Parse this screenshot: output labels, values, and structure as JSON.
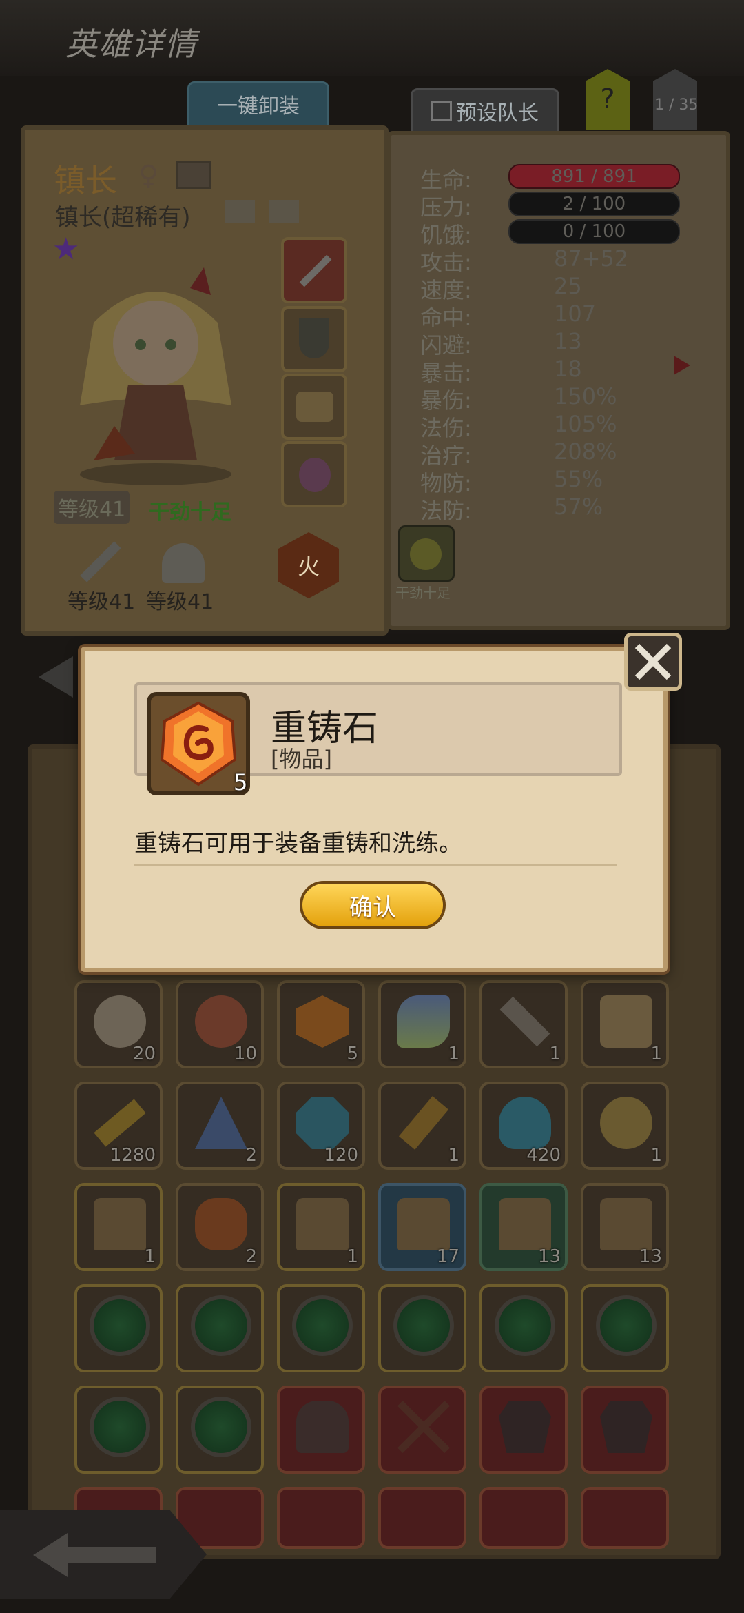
{
  "header": {
    "title": "英雄详情",
    "unequip_all": "一键卸装",
    "preset_leader": "预设队长",
    "help_symbol": "?",
    "page_counter": "1 / 35"
  },
  "hero": {
    "name": "镇长",
    "subtitle": "镇长(超稀有)",
    "level": "等级41",
    "status": "干劲十足",
    "equip_labels": [
      "等级41",
      "等级41"
    ],
    "element": "火",
    "status_badge_label": "干劲十足"
  },
  "stats": [
    {
      "label": "生命:",
      "value": "891 / 891"
    },
    {
      "label": "压力:",
      "value": "2 / 100"
    },
    {
      "label": "饥饿:",
      "value": "0 / 100"
    },
    {
      "label": "攻击:",
      "value": "87+52"
    },
    {
      "label": "速度:",
      "value": "25"
    },
    {
      "label": "命中:",
      "value": "107"
    },
    {
      "label": "闪避:",
      "value": "13"
    },
    {
      "label": "暴击:",
      "value": "18"
    },
    {
      "label": "暴伤:",
      "value": "150%"
    },
    {
      "label": "法伤:",
      "value": "105%"
    },
    {
      "label": "治疗:",
      "value": "208%"
    },
    {
      "label": "物防:",
      "value": "55%"
    },
    {
      "label": "法防:",
      "value": "57%"
    }
  ],
  "inventory": [
    {
      "icon": "hero-portrait-green-icon",
      "count": "20"
    },
    {
      "icon": "hero-portrait-red-icon",
      "count": "10"
    },
    {
      "icon": "reforge-stone-icon",
      "count": "5"
    },
    {
      "icon": "rainbow-crystal-icon",
      "count": "1"
    },
    {
      "icon": "dagger-icon",
      "count": "1"
    },
    {
      "icon": "scroll-icon",
      "count": "1"
    },
    {
      "icon": "golden-key-icon",
      "count": "1280"
    },
    {
      "icon": "blue-pyramid-icon",
      "count": "2"
    },
    {
      "icon": "cyan-rune-icon",
      "count": "120"
    },
    {
      "icon": "gold-wand-icon",
      "count": "1"
    },
    {
      "icon": "potion-icon",
      "count": "420"
    },
    {
      "icon": "gold-amulet-icon",
      "count": "1"
    },
    {
      "icon": "chest-icon",
      "count": "1"
    },
    {
      "icon": "pirate-figure-icon",
      "count": "2"
    },
    {
      "icon": "chest-icon",
      "count": "1"
    },
    {
      "icon": "blue-chest-icon",
      "count": "17"
    },
    {
      "icon": "green-chest-icon",
      "count": "13"
    },
    {
      "icon": "silver-chest-icon",
      "count": "13"
    },
    {
      "icon": "green-gem-icon",
      "count": ""
    },
    {
      "icon": "green-gem-icon",
      "count": ""
    },
    {
      "icon": "green-gem-icon",
      "count": ""
    },
    {
      "icon": "green-gem-icon",
      "count": ""
    },
    {
      "icon": "green-gem-icon",
      "count": ""
    },
    {
      "icon": "green-gem-icon",
      "count": ""
    },
    {
      "icon": "green-gem-icon",
      "count": ""
    },
    {
      "icon": "green-gem-icon",
      "count": ""
    },
    {
      "icon": "helmet-icon",
      "count": ""
    },
    {
      "icon": "crossed-swords-icon",
      "count": ""
    },
    {
      "icon": "armor-icon",
      "count": ""
    },
    {
      "icon": "armor-icon",
      "count": ""
    }
  ],
  "dialog": {
    "item_name": "重铸石",
    "item_type": "[物品]",
    "item_count": "5",
    "description": "重铸石可用于装备重铸和洗练。",
    "confirm_label": "确认"
  },
  "colors": {
    "dialog_bg": "#e6d4b2",
    "confirm_button": "#f2b92a",
    "hp_bar": "#7a1d26"
  }
}
